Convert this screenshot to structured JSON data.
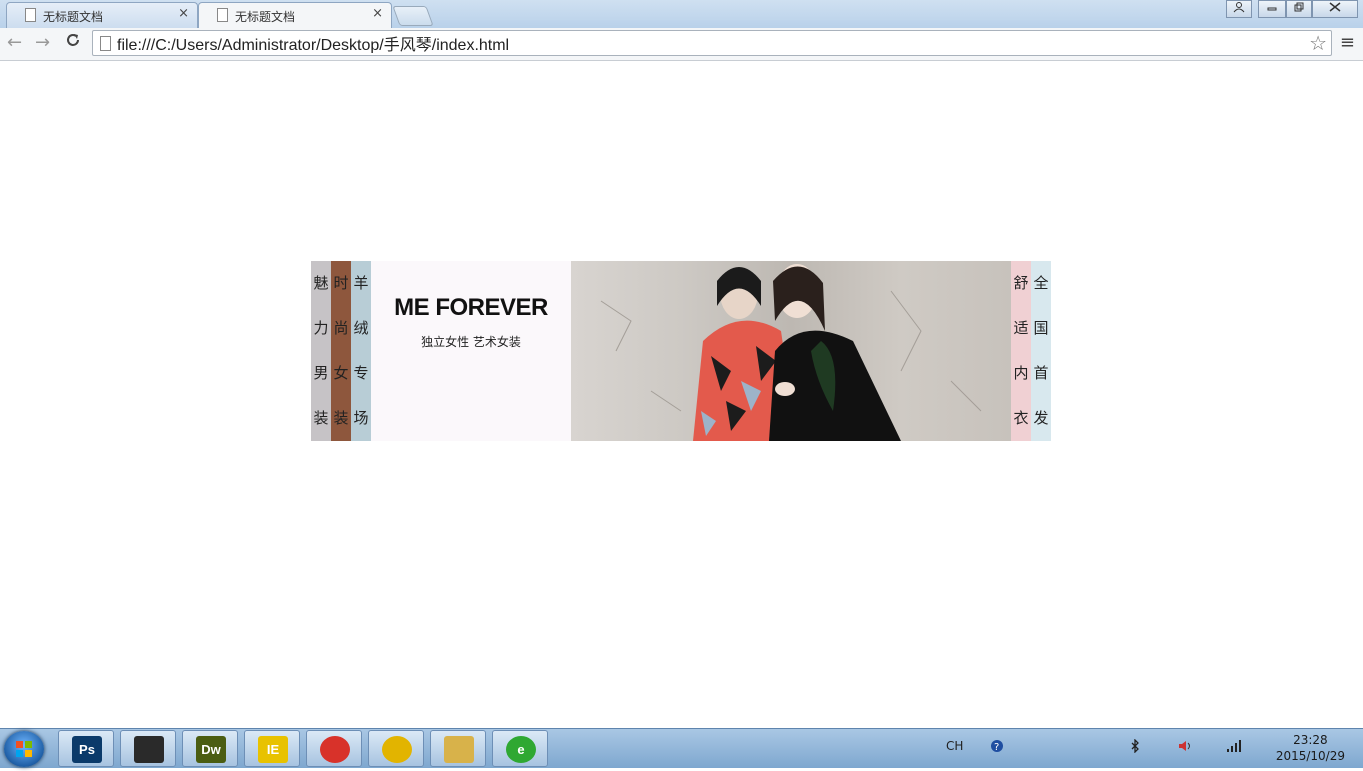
{
  "browser": {
    "tabs": [
      {
        "title": "无标题文档",
        "close": "×",
        "active": false
      },
      {
        "title": "无标题文档",
        "close": "×",
        "active": true
      }
    ],
    "address": "file:///C:/Users/Administrator/Desktop/手风琴/index.html",
    "back_icon": "←",
    "forward_icon": "→",
    "reload_icon": "C",
    "star_icon": "☆",
    "menu_icon": "≡"
  },
  "banner": {
    "columns_left": [
      {
        "chars": [
          "魅",
          "力",
          "男",
          "装"
        ],
        "color": "#c6c3c6"
      },
      {
        "chars": [
          "时",
          "尚",
          "女",
          "装"
        ],
        "color": "#8e573d"
      },
      {
        "chars": [
          "羊",
          "绒",
          "专",
          "场"
        ],
        "color": "#b8cdd6"
      }
    ],
    "brand_title": "ME FOREVER",
    "brand_subtitle": "独立女性 艺术女装",
    "columns_right": [
      {
        "chars": [
          "舒",
          "适",
          "内",
          "衣"
        ],
        "color": "#f0d0d3"
      },
      {
        "chars": [
          "全",
          "国",
          "首",
          "发"
        ],
        "color": "#d8e8ee"
      }
    ]
  },
  "taskbar": {
    "apps": [
      {
        "name": "Ps",
        "color": "#0b3a6a"
      },
      {
        "name": "QQ",
        "color": "#2a2a2a"
      },
      {
        "name": "Dw",
        "color": "#4b5d12"
      },
      {
        "name": "IE",
        "color": "#e8c200"
      },
      {
        "name": "Chrome",
        "color": "#d8322a"
      },
      {
        "name": "Music",
        "color": "#e2b400"
      },
      {
        "name": "Explorer",
        "color": "#d8b24a"
      },
      {
        "name": "e",
        "color": "#2fa832"
      }
    ],
    "lang": "CH",
    "time": "23:28",
    "date": "2015/10/29"
  }
}
